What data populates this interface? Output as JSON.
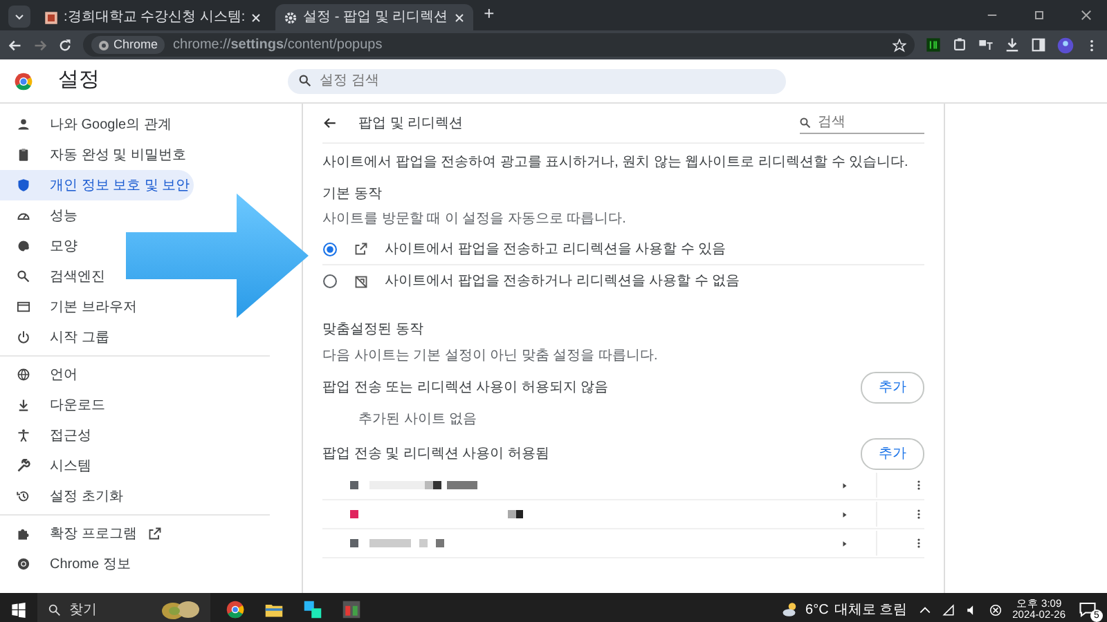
{
  "browser": {
    "tabs": [
      {
        "title": ":경희대학교 수강신청 시스템:",
        "selected": false
      },
      {
        "title": "설정 - 팝업 및 리디렉션",
        "selected": true
      }
    ],
    "new_tab": "+",
    "address": {
      "chip": "Chrome",
      "url": "chrome://**settings**/content/popups"
    }
  },
  "header": {
    "title": "설정",
    "search_placeholder": "설정 검색"
  },
  "sidebar": {
    "groups": [
      {
        "items": [
          {
            "label": "나와 Google의 관계",
            "selected": false,
            "external": false
          },
          {
            "label": "자동 완성 및 비밀번호",
            "selected": false,
            "external": false
          },
          {
            "label": "개인 정보 보호 및 보안",
            "selected": true,
            "external": false
          },
          {
            "label": "성능",
            "selected": false,
            "external": false
          },
          {
            "label": "모양",
            "selected": false,
            "external": false
          },
          {
            "label": "검색엔진",
            "selected": false,
            "external": false
          },
          {
            "label": "기본 브라우저",
            "selected": false,
            "external": false
          },
          {
            "label": "시작 그룹",
            "selected": false,
            "external": false
          }
        ]
      },
      {
        "items": [
          {
            "label": "언어",
            "selected": false,
            "external": false
          },
          {
            "label": "다운로드",
            "selected": false,
            "external": false
          },
          {
            "label": "접근성",
            "selected": false,
            "external": false
          },
          {
            "label": "시스템",
            "selected": false,
            "external": false
          },
          {
            "label": "설정 초기화",
            "selected": false,
            "external": false
          }
        ]
      },
      {
        "items": [
          {
            "label": "확장 프로그램",
            "selected": false,
            "external": true
          },
          {
            "label": "Chrome 정보",
            "selected": false,
            "external": false
          }
        ]
      }
    ]
  },
  "page": {
    "title": "팝업 및 리디렉션",
    "search_placeholder": "검색",
    "description": "사이트에서 팝업을 전송하여 광고를 표시하거나, 원치 않는 웹사이트로 리디렉션할 수 있습니다.",
    "default_behavior": {
      "heading": "기본 동작",
      "subtext": "사이트를 방문할 때 이 설정을 자동으로 따릅니다.",
      "options": [
        {
          "label": "사이트에서 팝업을 전송하고 리디렉션을 사용할 수 있음",
          "kind": "allow",
          "selected": true
        },
        {
          "label": "사이트에서 팝업을 전송하거나 리디렉션을 사용할 수 없음",
          "kind": "block",
          "selected": false
        }
      ]
    },
    "custom": {
      "heading": "맞춤설정된 동작",
      "subtext": "다음 사이트는 기본 설정이 아닌 맞춤 설정을 따릅니다.",
      "sections": [
        {
          "title": "팝업 전송 또는 리디렉션 사용이 허용되지 않음",
          "button": "추가",
          "empty_text": "추가된 사이트 없음"
        },
        {
          "title": "팝업 전송 및 리디렉션 사용이 허용됨",
          "button": "추가",
          "sites": [
            {
              "color": "#5f6368"
            },
            {
              "color": "#e0245e"
            },
            {
              "color": "#5f6368"
            }
          ]
        }
      ]
    }
  },
  "taskbar": {
    "search": "찾기",
    "weather": {
      "temp": "6°C",
      "text": "대체로 흐림"
    },
    "time": "오후 3:09",
    "date": "2024-02-26",
    "notifications": "5"
  }
}
